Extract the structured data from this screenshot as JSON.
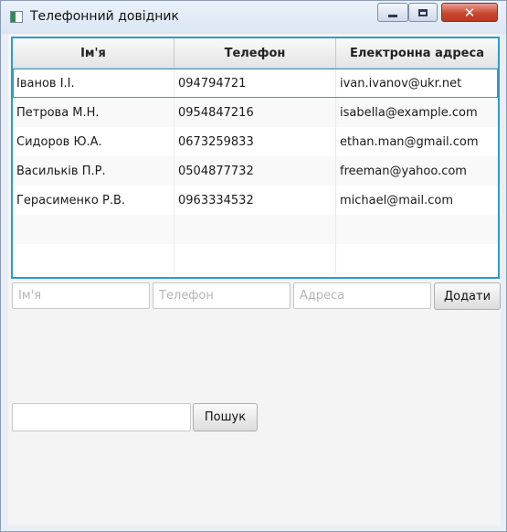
{
  "window": {
    "title": "Телефонний довідник",
    "close_glyph": "✕"
  },
  "table": {
    "columns": [
      "Ім'я",
      "Телефон",
      "Електронна адреса"
    ],
    "rows": [
      {
        "name": "Іванов І.І.",
        "phone": "094794721",
        "email": "ivan.ivanov@ukr.net"
      },
      {
        "name": "Петрова М.Н.",
        "phone": "0954847216",
        "email": "isabella@example.com"
      },
      {
        "name": "Сидоров Ю.А.",
        "phone": "0673259833",
        "email": "ethan.man@gmail.com"
      },
      {
        "name": "Васильків П.Р.",
        "phone": "0504877732",
        "email": "freeman@yahoo.com"
      },
      {
        "name": "Герасименко Р.В.",
        "phone": "0963334532",
        "email": "michael@mail.com"
      }
    ],
    "selected_row": 0
  },
  "add_form": {
    "name_placeholder": "Ім'я",
    "phone_placeholder": "Телефон",
    "address_placeholder": "Адреса",
    "add_label": "Додати"
  },
  "search": {
    "value": "",
    "button_label": "Пошук"
  },
  "colors": {
    "accent": "#2a9bd3",
    "close_button": "#c8482f"
  }
}
